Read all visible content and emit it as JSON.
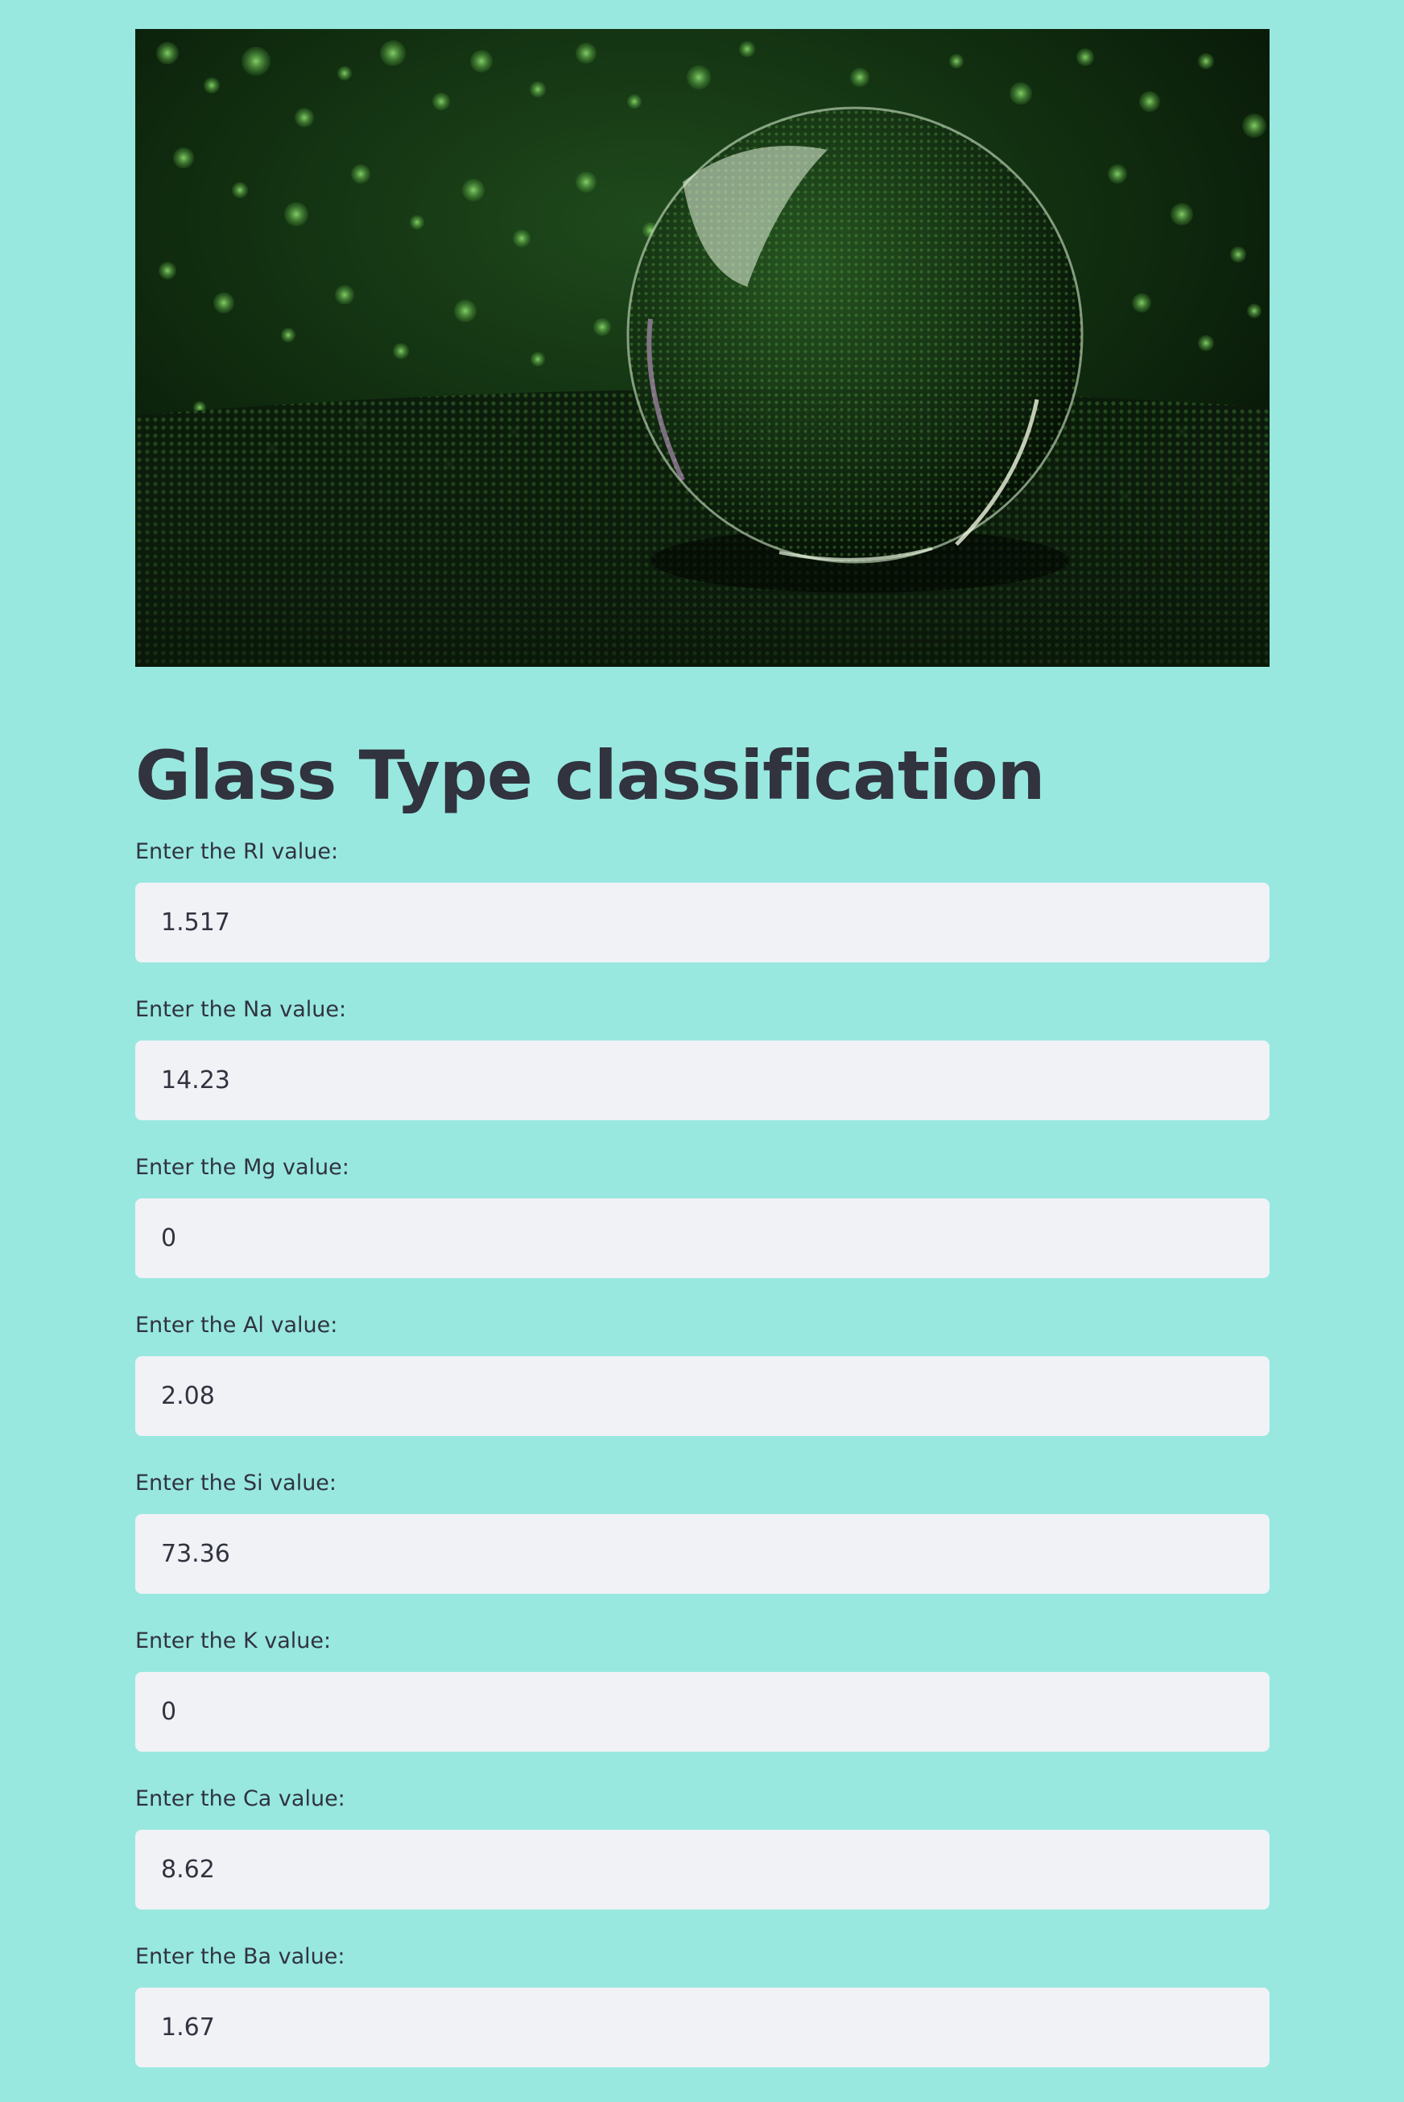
{
  "page": {
    "title": "Glass Type classification",
    "background": "#98e8e0"
  },
  "hero": {
    "icon": "glass-sphere-bokeh-image"
  },
  "fields": [
    {
      "label": "Enter the RI value:",
      "value": "1.517"
    },
    {
      "label": "Enter the Na value:",
      "value": "14.23"
    },
    {
      "label": "Enter the Mg value:",
      "value": "0"
    },
    {
      "label": "Enter the Al value:",
      "value": "2.08"
    },
    {
      "label": "Enter the Si value:",
      "value": "73.36"
    },
    {
      "label": "Enter the K value:",
      "value": "0"
    },
    {
      "label": "Enter the Ca value:",
      "value": "8.62"
    },
    {
      "label": "Enter the Ba value:",
      "value": "1.67"
    }
  ]
}
